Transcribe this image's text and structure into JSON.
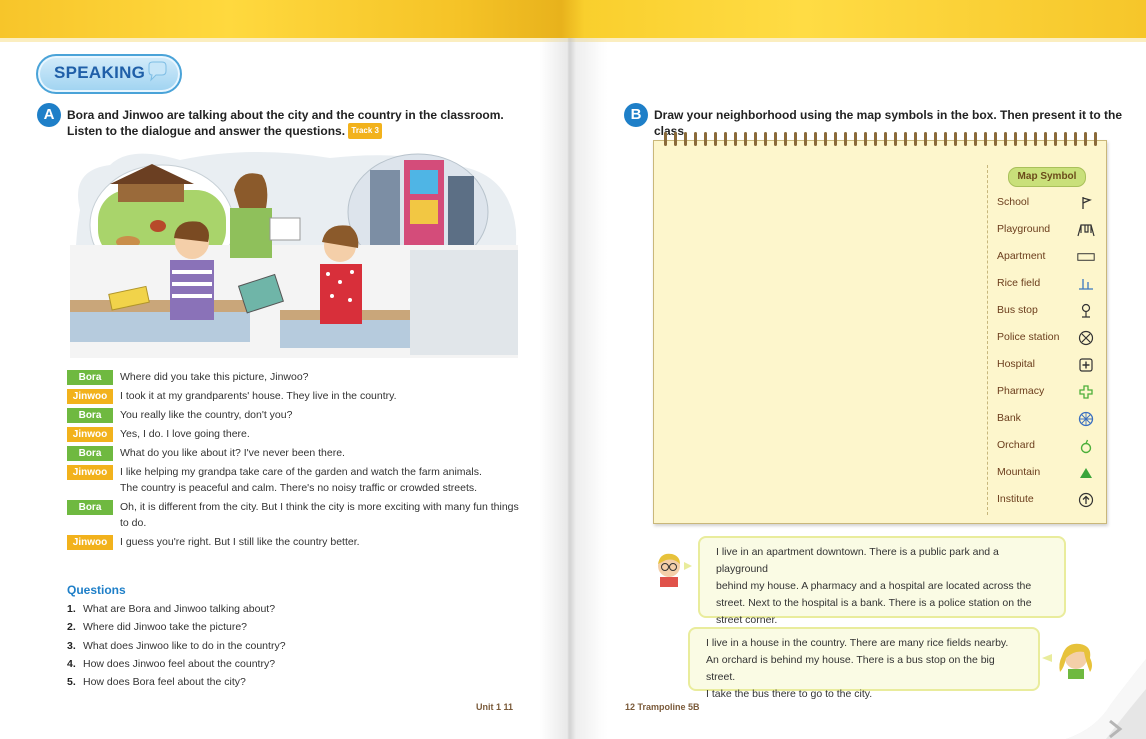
{
  "left_page": {
    "badge": "SPEAKING",
    "section_a": {
      "letter": "A",
      "instruction": "Bora and Jinwoo are talking about the city and the country in the classroom. Listen to the dialogue and answer the questions.",
      "track": "Track 3"
    },
    "dialogue": [
      {
        "speaker": "Bora",
        "text": "Where did you take this picture, Jinwoo?"
      },
      {
        "speaker": "Jinwoo",
        "text": "I took it at my grandparents' house. They live in the country."
      },
      {
        "speaker": "Bora",
        "text": "You really like the country, don't you?"
      },
      {
        "speaker": "Jinwoo",
        "text": "Yes, I do. I love going there."
      },
      {
        "speaker": "Bora",
        "text": "What do you like about it? I've never been there."
      },
      {
        "speaker": "Jinwoo",
        "text": "I like helping my grandpa take care of the garden and watch the farm animals.",
        "text2": "The country is peaceful and calm. There's no noisy traffic or crowded streets."
      },
      {
        "speaker": "Bora",
        "text": "Oh, it is different from the city. But I think the city is more exciting with many fun things",
        "text2": "to do."
      },
      {
        "speaker": "Jinwoo",
        "text": "I guess you're right. But I still like the country better."
      }
    ],
    "questions_title": "Questions",
    "questions": [
      {
        "num": "1.",
        "text": "What are Bora and Jinwoo talking about?"
      },
      {
        "num": "2.",
        "text": "Where did Jinwoo take the picture?"
      },
      {
        "num": "3.",
        "text": "What does Jinwoo like to do in the country?"
      },
      {
        "num": "4.",
        "text": "How does Jinwoo feel about the country?"
      },
      {
        "num": "5.",
        "text": "How does Bora feel about the city?"
      }
    ],
    "folio": "Unit 1   11"
  },
  "right_page": {
    "section_b": {
      "letter": "B",
      "instruction": "Draw your neighborhood using the map symbols in the box. Then present it to the class."
    },
    "legend_title": "Map Symbol",
    "symbols": [
      {
        "label": "School",
        "icon": "flag-icon"
      },
      {
        "label": "Playground",
        "icon": "swing-icon"
      },
      {
        "label": "Apartment",
        "icon": "rectangle-icon"
      },
      {
        "label": "Rice field",
        "icon": "rice-field-icon"
      },
      {
        "label": "Bus stop",
        "icon": "bus-stop-icon"
      },
      {
        "label": "Police station",
        "icon": "circle-x-icon"
      },
      {
        "label": "Hospital",
        "icon": "square-cross-icon"
      },
      {
        "label": "Pharmacy",
        "icon": "green-cross-icon"
      },
      {
        "label": "Bank",
        "icon": "circle-cross-icon"
      },
      {
        "label": "Orchard",
        "icon": "apple-icon"
      },
      {
        "label": "Mountain",
        "icon": "triangle-icon"
      },
      {
        "label": "Institute",
        "icon": "circle-arrow-icon"
      }
    ],
    "speech1": [
      "I live in an apartment downtown. There is a public park and a playground",
      "behind my house. A pharmacy and a hospital are located across the",
      "street. Next to the hospital is a bank. There is a police station on the",
      "street corner."
    ],
    "speech2": [
      "I live in a house in the country. There are many rice fields nearby.",
      "An orchard is behind my house. There is a bus stop on the big street.",
      "I take the bus there to go to the city."
    ],
    "folio": "12  Trampoline 5B"
  },
  "colors": {
    "bora_tag": "#6fb940",
    "jinwoo_tag": "#f2b21c",
    "section_circle": "#1e7fc8",
    "notepad": "#fdf6cc"
  }
}
